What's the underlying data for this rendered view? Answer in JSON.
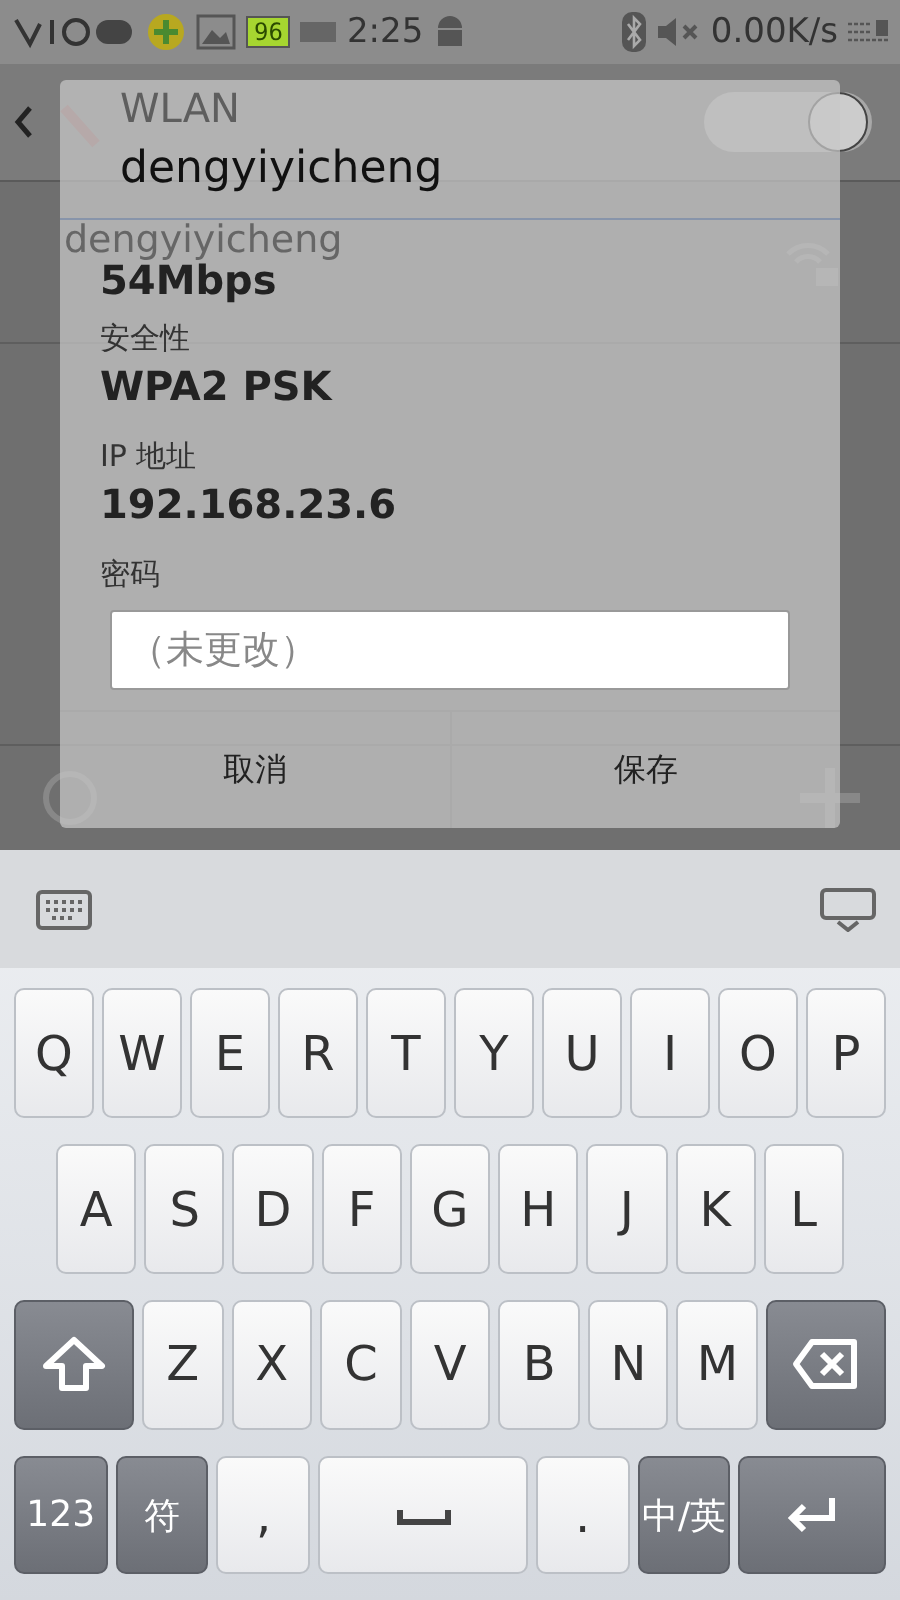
{
  "status_bar": {
    "battery": "96",
    "time": "2:25",
    "speed": "0.00K/s"
  },
  "wlan_page": {
    "title": "WLAN",
    "wlan_on": true,
    "network": {
      "name": "dengyiyicheng"
    }
  },
  "dialog": {
    "title": "dengyiyicheng",
    "speed": "54Mbps",
    "fields": [
      {
        "label": "安全性",
        "value": "WPA2 PSK"
      },
      {
        "label": "IP 地址",
        "value": "192.168.23.6"
      }
    ],
    "password": {
      "label": "密码",
      "placeholder": "（未更改）"
    },
    "buttons": [
      "取消",
      "保存"
    ]
  },
  "keyboard": {
    "rows": [
      {
        "keys": [
          {
            "kind": "char",
            "label": "Q"
          },
          {
            "kind": "char",
            "label": "W"
          },
          {
            "kind": "char",
            "label": "E"
          },
          {
            "kind": "char",
            "label": "R"
          },
          {
            "kind": "char",
            "label": "T"
          },
          {
            "kind": "char",
            "label": "Y"
          },
          {
            "kind": "char",
            "label": "U"
          },
          {
            "kind": "char",
            "label": "I"
          },
          {
            "kind": "char",
            "label": "O"
          },
          {
            "kind": "char",
            "label": "P"
          }
        ]
      },
      {
        "keys": [
          {
            "kind": "char",
            "label": "A"
          },
          {
            "kind": "char",
            "label": "S"
          },
          {
            "kind": "char",
            "label": "D"
          },
          {
            "kind": "char",
            "label": "F"
          },
          {
            "kind": "char",
            "label": "G"
          },
          {
            "kind": "char",
            "label": "H"
          },
          {
            "kind": "char",
            "label": "J"
          },
          {
            "kind": "char",
            "label": "K"
          },
          {
            "kind": "char",
            "label": "L"
          }
        ]
      },
      {
        "keys": [
          {
            "kind": "shift"
          },
          {
            "kind": "char",
            "label": "Z"
          },
          {
            "kind": "char",
            "label": "X"
          },
          {
            "kind": "char",
            "label": "C"
          },
          {
            "kind": "char",
            "label": "V"
          },
          {
            "kind": "char",
            "label": "B"
          },
          {
            "kind": "char",
            "label": "N"
          },
          {
            "kind": "char",
            "label": "M"
          },
          {
            "kind": "backspace"
          }
        ]
      },
      {
        "keys": [
          {
            "kind": "fn",
            "label": "123"
          },
          {
            "kind": "fn",
            "label": "符"
          },
          {
            "kind": "char",
            "label": ","
          },
          {
            "kind": "space"
          },
          {
            "kind": "char",
            "label": "."
          },
          {
            "kind": "fn",
            "label": "中/英"
          },
          {
            "kind": "enter"
          }
        ]
      }
    ]
  }
}
